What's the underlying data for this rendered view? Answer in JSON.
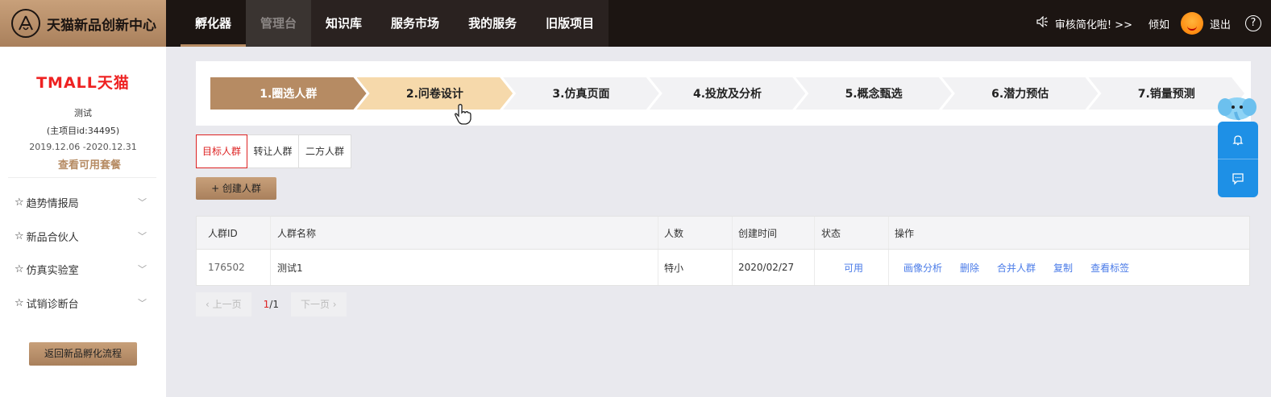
{
  "brand": {
    "title": "天猫新品创新中心"
  },
  "nav": {
    "items": [
      {
        "label": "孵化器"
      },
      {
        "label": "管理台"
      },
      {
        "label": "知识库"
      },
      {
        "label": "服务市场"
      },
      {
        "label": "我的服务"
      },
      {
        "label": "旧版项目"
      }
    ]
  },
  "header": {
    "notice": "审核简化啦! >>",
    "user_name": "倾如",
    "logout": "退出",
    "help": "?"
  },
  "sidebar": {
    "logo_text": "TMALL天猫",
    "project_name": "测试",
    "project_id": "(主项目id:34495)",
    "date_range": "2019.12.06 -2020.12.31",
    "package_link": "查看可用套餐",
    "menu": [
      {
        "label": "趋势情报局"
      },
      {
        "label": "新品合伙人"
      },
      {
        "label": "仿真实验室"
      },
      {
        "label": "试销诊断台"
      }
    ],
    "back_button": "返回新品孵化流程"
  },
  "steps": [
    {
      "label": "1.圈选人群"
    },
    {
      "label": "2.问卷设计"
    },
    {
      "label": "3.仿真页面"
    },
    {
      "label": "4.投放及分析"
    },
    {
      "label": "5.概念甄选"
    },
    {
      "label": "6.潜力预估"
    },
    {
      "label": "7.销量预测"
    }
  ],
  "tabs": [
    {
      "label": "目标人群"
    },
    {
      "label": "转让人群"
    },
    {
      "label": "二方人群"
    }
  ],
  "create_button": "+ 创建人群",
  "table": {
    "columns": [
      "人群ID",
      "人群名称",
      "人数",
      "创建时间",
      "状态",
      "操作"
    ],
    "rows": [
      {
        "id": "176502",
        "name": "测试1",
        "count": "特小",
        "created": "2020/02/27",
        "status": "可用",
        "ops": [
          "画像分析",
          "删除",
          "合并人群",
          "复制",
          "查看标签"
        ]
      }
    ]
  },
  "pager": {
    "prev": "上一页",
    "current": "1",
    "total": "/1",
    "next": "下一页"
  }
}
